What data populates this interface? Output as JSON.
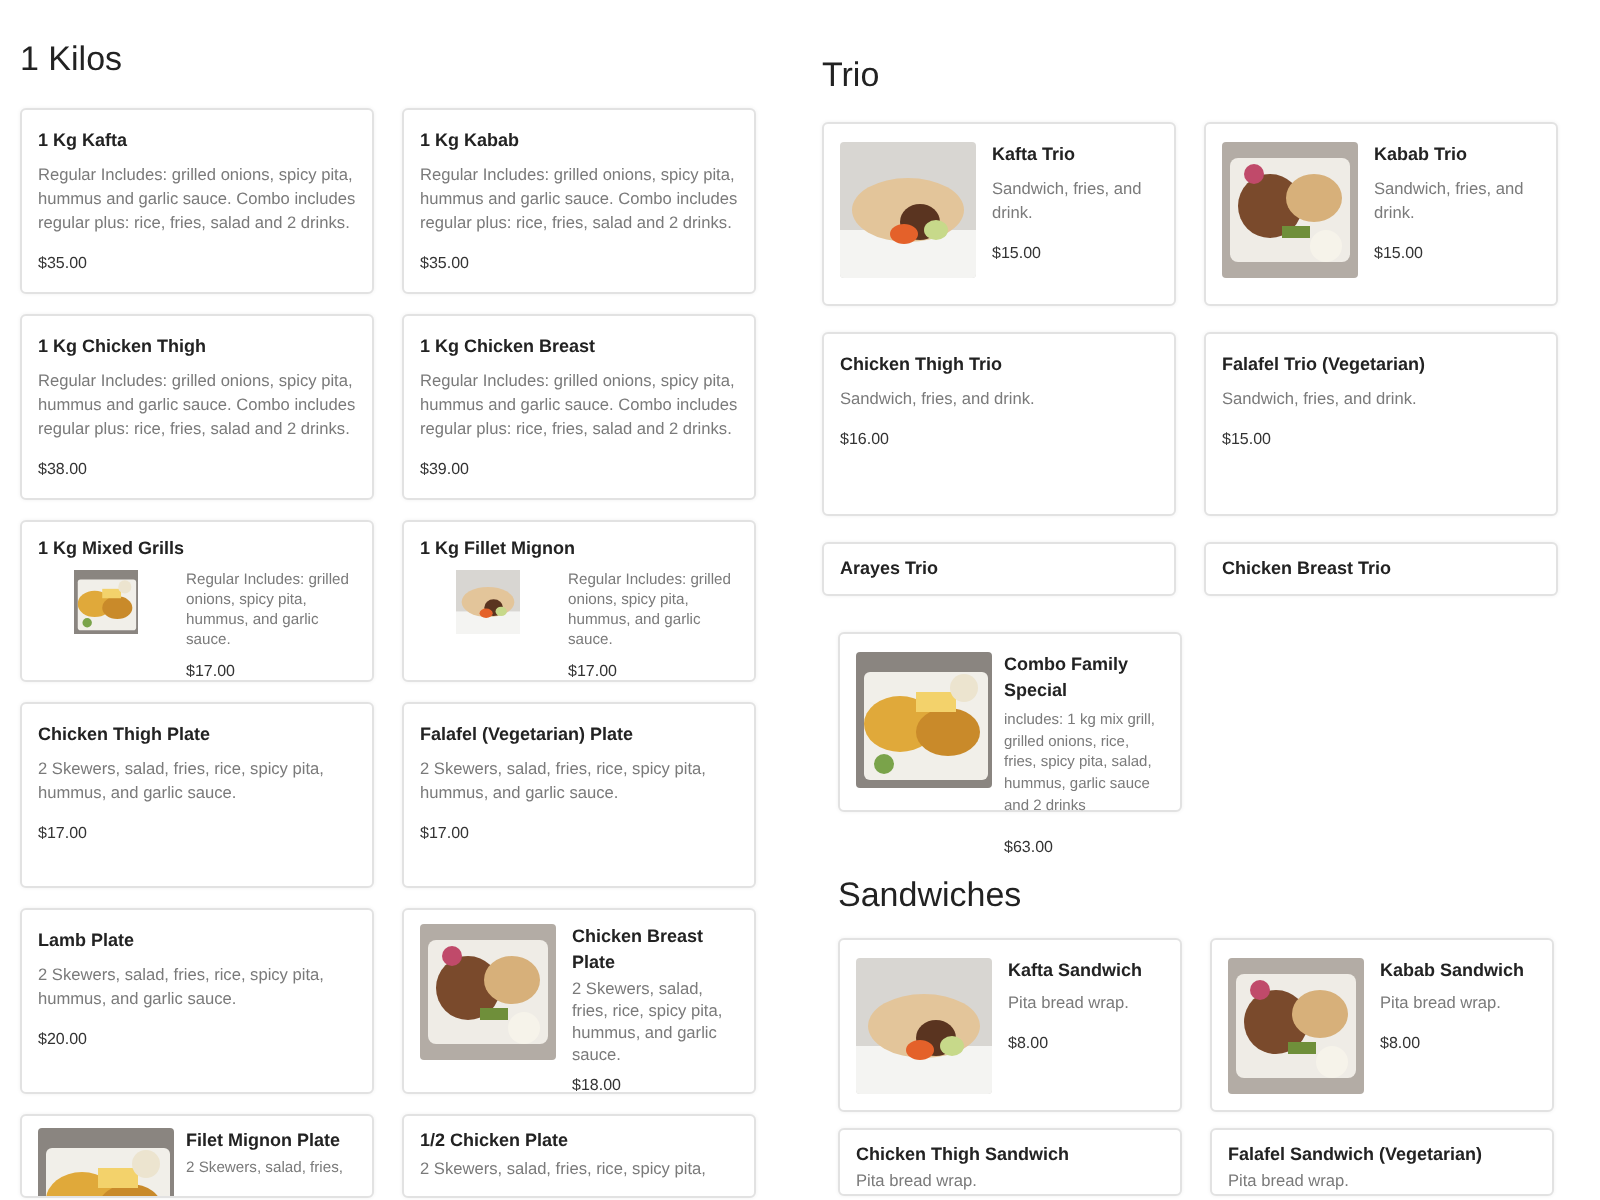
{
  "sections": [
    {
      "heading": "1 Kilos",
      "items": [
        {
          "kind": "text",
          "title": "1 Kg Kafta",
          "desc": "Regular Includes: grilled onions, spicy pita, hummus and garlic sauce. Combo includes regular plus: rice, fries, salad and 2 drinks.",
          "price": "$35.00"
        },
        {
          "kind": "text",
          "title": "1 Kg Kabab",
          "desc": "Regular Includes: grilled onions, spicy pita, hummus and garlic sauce. Combo includes regular plus: rice, fries, salad and 2 drinks.",
          "price": "$35.00"
        },
        {
          "kind": "text",
          "title": "1 Kg Chicken Thigh",
          "desc": "Regular Includes: grilled onions, spicy pita, hummus and garlic sauce. Combo includes regular plus: rice, fries, salad and 2 drinks.",
          "price": "$38.00"
        },
        {
          "kind": "text",
          "title": "1 Kg Chicken Breast",
          "desc": "Regular Includes: grilled onions, spicy pita, hummus and garlic sauce. Combo includes regular plus: rice, fries, salad and 2 drinks.",
          "price": "$39.00"
        },
        {
          "kind": "wide",
          "title": "1 Kg Mixed Grills",
          "desc": "Regular Includes: grilled onions, spicy pita, hummus, and garlic sauce.",
          "price": "$17.00"
        },
        {
          "kind": "wide",
          "title": "1 Kg Fillet Mignon",
          "desc": "Regular Includes: grilled onions, spicy pita, hummus, and garlic sauce.",
          "price": "$17.00"
        },
        {
          "kind": "text",
          "title": "Chicken Thigh Plate",
          "desc": "2 Skewers, salad, fries, rice, spicy pita, hummus, and garlic sauce.",
          "price": "$17.00"
        },
        {
          "kind": "text",
          "title": "Falafel (Vegetarian) Plate",
          "desc": "2 Skewers, salad, fries, rice, spicy pita, hummus, and garlic sauce.",
          "price": "$17.00"
        },
        {
          "kind": "text",
          "title": "Lamb Plate",
          "desc": "2 Skewers, salad, fries, rice, spicy pita, hummus, and garlic sauce.",
          "price": "$20.00"
        },
        {
          "kind": "picture",
          "title": "Chicken Breast Plate",
          "desc": "2 Skewers, salad, fries, rice, spicy pita, hummus, and garlic sauce.",
          "price": "$18.00"
        },
        {
          "kind": "picture",
          "title": "Filet Mignon Plate",
          "desc": "2 Skewers, salad, fries,"
        },
        {
          "kind": "text",
          "title": "1/2 Chicken Plate",
          "desc": "2 Skewers, salad, fries, rice, spicy pita,"
        }
      ]
    },
    {
      "heading": "Trio",
      "items": [
        {
          "kind": "picture",
          "title": "Kafta Trio",
          "desc": "Sandwich, fries, and drink.",
          "price": "$15.00"
        },
        {
          "kind": "picture",
          "title": "Kabab Trio",
          "desc": "Sandwich, fries, and drink.",
          "price": "$15.00"
        },
        {
          "kind": "text",
          "title": "Chicken Thigh Trio",
          "desc": "Sandwich, fries, and drink.",
          "price": "$16.00"
        },
        {
          "kind": "text",
          "title": "Falafel Trio (Vegetarian)",
          "desc": "Sandwich, fries, and drink.",
          "price": "$15.00"
        },
        {
          "kind": "text",
          "title": "Arayes Trio"
        },
        {
          "kind": "text",
          "title": "Chicken Breast Trio"
        }
      ]
    },
    {
      "items": [
        {
          "kind": "picture",
          "title": "Combo Family Special",
          "desc": "includes: 1 kg mix grill, grilled onions, rice, fries, spicy pita, salad, hummus, garlic sauce and 2 drinks",
          "price": "$63.00"
        }
      ]
    },
    {
      "heading": "Sandwiches",
      "items": [
        {
          "kind": "picture",
          "title": "Kafta Sandwich",
          "desc": "Pita bread wrap.",
          "price": "$8.00"
        },
        {
          "kind": "picture",
          "title": "Kabab Sandwich",
          "desc": "Pita bread wrap.",
          "price": "$8.00"
        },
        {
          "kind": "text",
          "title": "Chicken Thigh Sandwich",
          "desc": "Pita bread wrap."
        },
        {
          "kind": "text",
          "title": "Falafel Sandwich (Vegetarian)",
          "desc": "Pita bread wrap."
        }
      ]
    }
  ]
}
